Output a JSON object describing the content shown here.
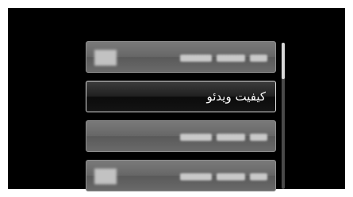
{
  "menu": {
    "items": [
      {
        "label": "",
        "has_icon": true
      },
      {
        "label": "کیفیت ویدئو",
        "selected": true
      },
      {
        "label": "",
        "has_icon": false
      },
      {
        "label": "",
        "has_icon": true
      }
    ]
  },
  "scroll": {
    "position_fraction": 0.0,
    "visible_fraction": 0.25
  },
  "colors": {
    "background": "#000000",
    "item": "#666666",
    "selected_item": "#1a1a1a",
    "border": "#8f8f8f",
    "text": "#ffffff"
  }
}
